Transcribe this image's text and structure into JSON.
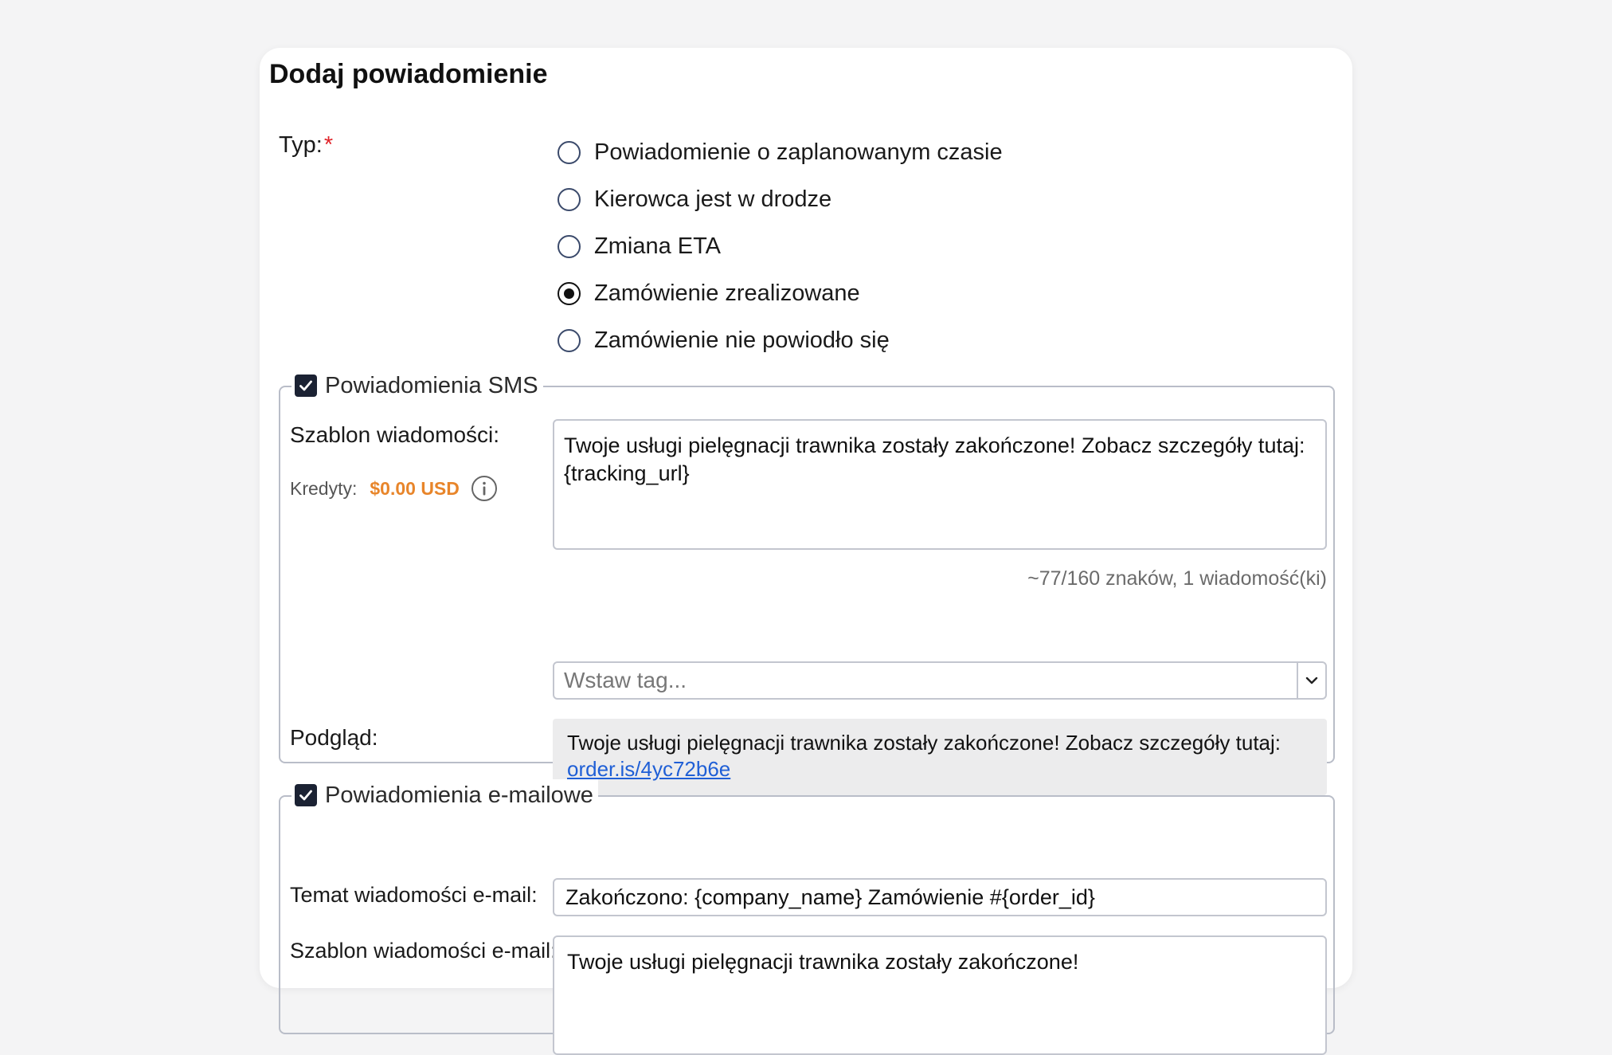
{
  "form": {
    "title": "Dodaj powiadomienie",
    "type_label": "Typ:",
    "required_mark": "*",
    "types": [
      {
        "label": "Powiadomienie o zaplanowanym czasie",
        "checked": false
      },
      {
        "label": "Kierowca jest w drodze",
        "checked": false
      },
      {
        "label": "Zmiana ETA",
        "checked": false
      },
      {
        "label": "Zamówienie zrealizowane",
        "checked": true
      },
      {
        "label": "Zamówienie nie powiodło się",
        "checked": false
      }
    ]
  },
  "sms": {
    "enabled": true,
    "legend": "Powiadomienia SMS",
    "template_label": "Szablon wiadomości:",
    "credits_label": "Kredyty:",
    "credits_value": "$0.00 USD",
    "template_line1": "Twoje usługi pielęgnacji trawnika zostały zakończone! Zobacz szczegóły tutaj:",
    "template_line2": "{tracking_url}",
    "counter": "~77/160 znaków, 1 wiadomość(ki)",
    "insert_tag_placeholder": "Wstaw tag...",
    "preview_label": "Podgląd:",
    "preview_text": "Twoje usługi pielęgnacji trawnika zostały zakończone! Zobacz szczegóły tutaj:",
    "preview_link": "order.is/4yc72b6e"
  },
  "email": {
    "enabled": true,
    "legend": "Powiadomienia e-mailowe",
    "subject_label": "Temat wiadomości e-mail:",
    "subject_value": "Zakończono: {company_name} Zamówienie #{order_id}",
    "template_label": "Szablon wiadomości e-mail:",
    "template_value": "Twoje usługi pielęgnacji trawnika zostały zakończone!"
  },
  "colors": {
    "credits": "#e8852a",
    "link": "#1f5fd6",
    "checkbox": "#1b2233",
    "required": "#e0242a"
  }
}
